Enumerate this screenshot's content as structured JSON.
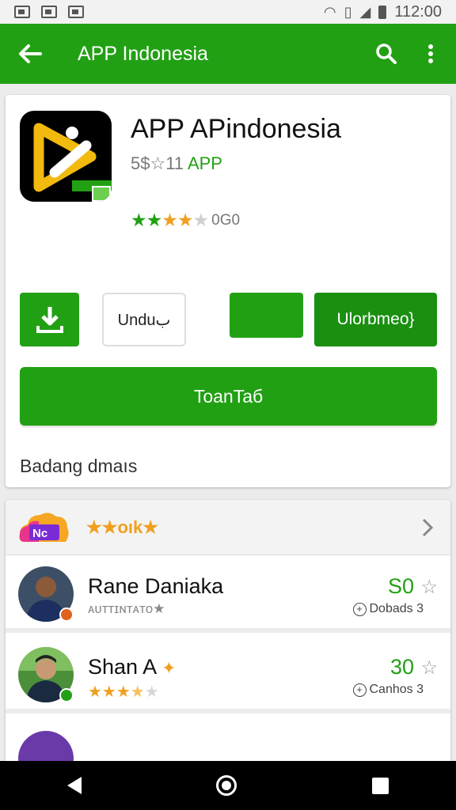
{
  "status_bar": {
    "time": "112:00"
  },
  "app_bar": {
    "title": "APP Indonesia"
  },
  "app": {
    "name": "APP APindonesia",
    "sub_prefix": "5$☆11",
    "sub_label": "APP",
    "rating": 3.5,
    "rating_count": "0G0",
    "buttons": {
      "unduh": "Unduب",
      "info": "Ulorbmeo}",
      "install": "ToanTaб"
    },
    "note": "Badang dmaıs"
  },
  "reviews": {
    "header_label": "★★oık★",
    "items": [
      {
        "name": "Rane Daniaka",
        "stars_text": "ᴀᴜᴛᴛɪɴᴛᴀᴛᴏ★",
        "score": "S0",
        "meta": "Dobads 3"
      },
      {
        "name": "Shan A",
        "stars_text": "★★★★★",
        "rating": 3.5,
        "score": "30",
        "meta": "Canhos 3"
      },
      {
        "name": "",
        "stars_text": "",
        "score": "",
        "meta": ""
      }
    ]
  },
  "colors": {
    "primary": "#22a014",
    "accent": "#f0a020"
  }
}
